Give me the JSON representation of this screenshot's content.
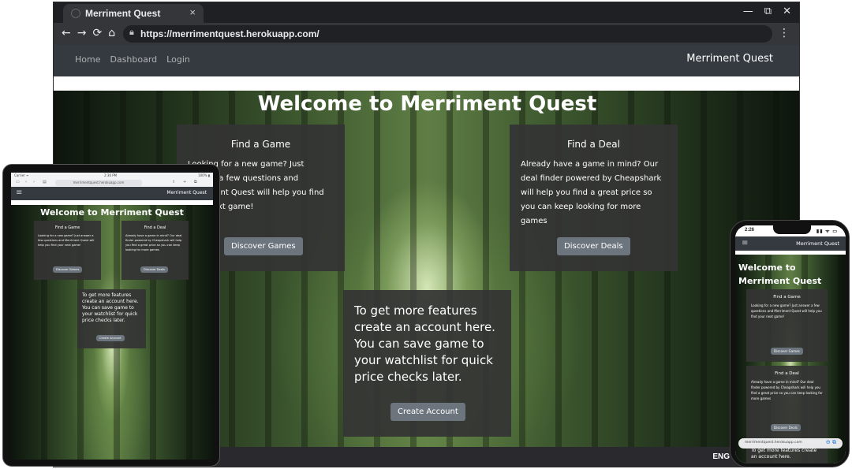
{
  "desktop": {
    "tab_title": "Merriment Quest",
    "tab_close": "×",
    "window_controls": [
      "—",
      "⧉",
      "✕"
    ],
    "nav_buttons": [
      "←",
      "→",
      "⟳",
      "⌂"
    ],
    "url": "https://merrimentquest.herokuapp.com/",
    "nav_links": [
      "Home",
      "Dashboard",
      "Login"
    ],
    "brand": "Merriment Quest",
    "heading": "Welcome to Merriment Quest",
    "find_game": {
      "title": "Find a Game",
      "text": "Looking for a new game? Just answer a few questions and Merriment Quest will help you find your next game!",
      "button": "Discover Games"
    },
    "find_deal": {
      "title": "Find a Deal",
      "text": "Already have a game in mind? Our deal finder powered by Cheapshark will help you find a great price so you can keep looking for more games",
      "button": "Discover Deals"
    },
    "account": {
      "text": "To get more features create an account here. You can save game to your watchlist for quick price checks later.",
      "button": "Create Account"
    },
    "taskbar_lang": "ENG"
  },
  "tablet": {
    "status_left": "Carrier ᯤ",
    "status_time": "2:36 PM",
    "status_right": "100% ▮",
    "url": "merrimentquest.herokuapp.com",
    "brand": "Merriment Quest",
    "heading": "Welcome to Merriment Quest",
    "find_game": {
      "title": "Find a Game",
      "text": "Looking for a new game? Just answer a few questions and Merriment Quest will help you find your next game!",
      "button": "Discover Games"
    },
    "find_deal": {
      "title": "Find a Deal",
      "text": "Already have a game in mind? Our deal finder powered by Cheapshark will help you find a great price so you can keep looking for more games",
      "button": "Discover Deals"
    },
    "account": {
      "text": "To get more features create an account here. You can save game to your watchlist for quick price checks later.",
      "button": "Create Account"
    }
  },
  "phone": {
    "status_time": "2:26",
    "status_icons": "▮▮ ᯤ ▭",
    "brand": "Merriment Quest",
    "heading": "Welcome to Merriment Quest",
    "find_game": {
      "title": "Find a Game",
      "text": "Looking for a new game? Just answer a few questions and Merriment Quest will help you find your next game!",
      "button": "Discover Games"
    },
    "find_deal": {
      "title": "Find a Deal",
      "text": "Already have a game in mind? Our deal finder powered by Cheapshark will help you find a great price so you can keep looking for more games",
      "button": "Discover Deals"
    },
    "account": {
      "text": "To get more features create an account here."
    },
    "url": "merrimentquest.herokuapp.com"
  }
}
